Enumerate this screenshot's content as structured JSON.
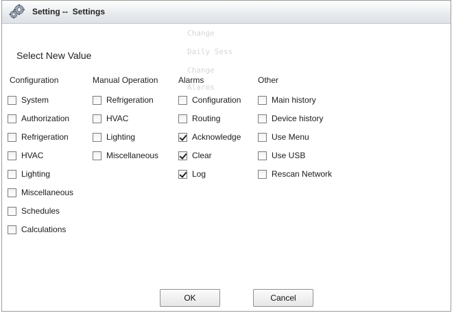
{
  "window": {
    "title": "Setting --  Settings",
    "icon": "gears-icon"
  },
  "background_text": [
    "Change",
    "Daily Sess",
    "Change",
    "Alarms"
  ],
  "dialog": {
    "subtitle": "Select New Value"
  },
  "columns": [
    {
      "header": "Configuration",
      "items": [
        {
          "label": "System",
          "checked": false
        },
        {
          "label": "Authorization",
          "checked": false
        },
        {
          "label": "Refrigeration",
          "checked": false
        },
        {
          "label": "HVAC",
          "checked": false
        },
        {
          "label": "Lighting",
          "checked": false
        },
        {
          "label": "Miscellaneous",
          "checked": false
        },
        {
          "label": "Schedules",
          "checked": false
        },
        {
          "label": "Calculations",
          "checked": false
        }
      ]
    },
    {
      "header": "Manual Operation",
      "items": [
        {
          "label": "Refrigeration",
          "checked": false
        },
        {
          "label": "HVAC",
          "checked": false
        },
        {
          "label": "Lighting",
          "checked": false
        },
        {
          "label": "Miscellaneous",
          "checked": false
        }
      ]
    },
    {
      "header": "Alarms",
      "items": [
        {
          "label": "Configuration",
          "checked": false
        },
        {
          "label": "Routing",
          "checked": false
        },
        {
          "label": "Acknowledge",
          "checked": true
        },
        {
          "label": "Clear",
          "checked": true
        },
        {
          "label": "Log",
          "checked": true
        }
      ]
    },
    {
      "header": "Other",
      "items": [
        {
          "label": "Main history",
          "checked": false
        },
        {
          "label": "Device history",
          "checked": false
        },
        {
          "label": "Use Menu",
          "checked": false
        },
        {
          "label": "Use USB",
          "checked": false
        },
        {
          "label": "Rescan Network",
          "checked": false
        }
      ]
    }
  ],
  "buttons": {
    "ok": "OK",
    "cancel": "Cancel"
  }
}
